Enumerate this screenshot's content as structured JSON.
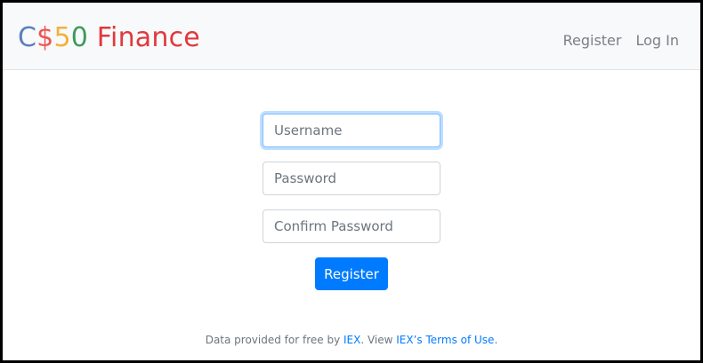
{
  "brand": {
    "c": "C",
    "dollar": "$",
    "five": "5",
    "zero": "0",
    "finance": " Finance"
  },
  "nav": {
    "register": "Register",
    "login": "Log In"
  },
  "form": {
    "username_placeholder": "Username",
    "password_placeholder": "Password",
    "confirm_placeholder": "Confirm Password",
    "submit_label": "Register"
  },
  "footer": {
    "prefix": "Data provided for free by ",
    "iex_link": "IEX",
    "middle": ". View ",
    "terms_link": "IEX’s Terms of Use",
    "suffix": "."
  },
  "colors": {
    "primary": "#007bff",
    "navbar_bg": "#f8f9fa",
    "brand_c": "#5b7fc1",
    "brand_dollar": "#f05454",
    "brand_5": "#f1b33b",
    "brand_0": "#3d9a5c",
    "brand_finance": "#e0393e"
  }
}
